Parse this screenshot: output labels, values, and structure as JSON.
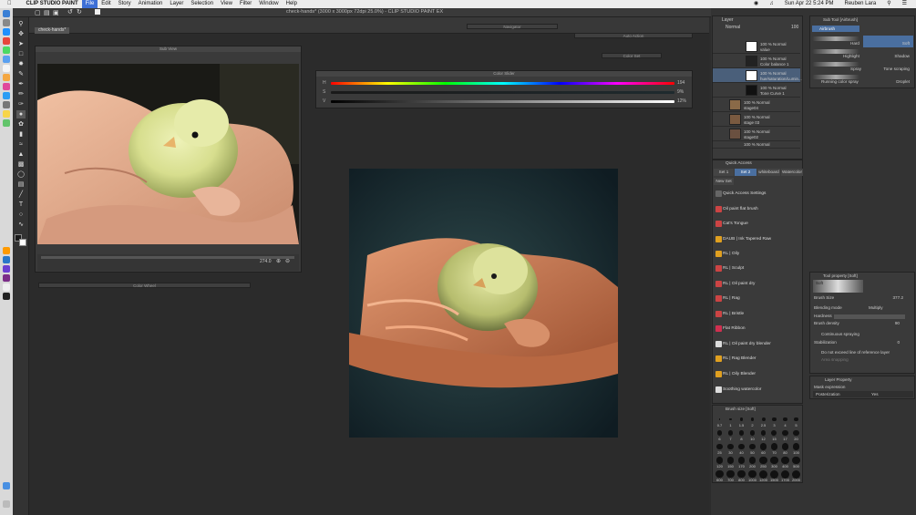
{
  "menubar": {
    "app_name": "CLIP STUDIO PAINT",
    "items": [
      "File",
      "Edit",
      "Story",
      "Animation",
      "Layer",
      "Selection",
      "View",
      "Filter",
      "Window",
      "Help"
    ],
    "active": "File",
    "clock": "Sun Apr 22  5:24 PM",
    "user": "Reuben Lara"
  },
  "window": {
    "title": "check-hands* (3000 x 3000px 72dpi 25.0%)  - CLIP STUDIO PAINT EX",
    "doc_tab": "check-hands*"
  },
  "panels": {
    "sub_view": {
      "title": "Sub View",
      "zoom": "274.0"
    },
    "navigator": {
      "title": "Navigator"
    },
    "auto_action": {
      "title": "Auto Action"
    },
    "color_set": {
      "title": "Color Set"
    },
    "color_wheel": {
      "title": "Color Wheel"
    },
    "color_slider": {
      "title": "Color Slider",
      "rows": [
        {
          "label": "H",
          "value": "194"
        },
        {
          "label": "S",
          "value": "9%"
        },
        {
          "label": "V",
          "value": "12%"
        }
      ]
    }
  },
  "layers": {
    "title": "Layer",
    "blend_mode": "Normal",
    "opacity": "100",
    "rows": [
      {
        "line1": "100 % Normal",
        "line2": "value"
      },
      {
        "line1": "100 % Normal",
        "line2": "Color balance 1"
      },
      {
        "line1": "100 % Normal",
        "line2": "hue/saturation/Lumin..."
      },
      {
        "line1": "100 % Normal",
        "line2": "Tone Curve 1"
      },
      {
        "line1": "100 % Normal",
        "line2": "stage04"
      },
      {
        "line1": "100 % Normal",
        "line2": "stage 03"
      },
      {
        "line1": "100 % Normal",
        "line2": "stage02"
      },
      {
        "line1": "100 % Normal",
        "line2": ""
      }
    ]
  },
  "quick_access": {
    "title": "Quick Access",
    "tabs": [
      "Set 1",
      "Set 2",
      "whiteboard",
      "Watercolor",
      "New Set"
    ],
    "settings_label": "Quick Access Settings",
    "items": [
      "Oil paint flat brush",
      "Cat's Tongue",
      "DAUB | Ink Tapered Raw",
      "RL | Oily",
      "RL | Sculpt",
      "RL | Oil paint dry",
      "RL | Rag",
      "RL | Bristle",
      "Flat Ribbon",
      "RL | Oil paint dry blender",
      "RL | Rag Blender",
      "RL | Oily Blender",
      "Soothing watercolor"
    ]
  },
  "brush_size": {
    "title": "Brush size [Soft]",
    "sizes": [
      "0.7",
      "1",
      "1.5",
      "2",
      "2.5",
      "3",
      "4",
      "5",
      "6",
      "7",
      "8",
      "10",
      "12",
      "15",
      "17",
      "20",
      "25",
      "30",
      "40",
      "50",
      "60",
      "70",
      "80",
      "100",
      "120",
      "150",
      "170",
      "200",
      "250",
      "300",
      "400",
      "500",
      "600",
      "700",
      "800",
      "1000",
      "1200",
      "1500",
      "1700",
      "2000"
    ]
  },
  "sub_tool": {
    "title": "Sub Tool [Airbrush]",
    "group": "Airbrush",
    "items": [
      {
        "left": "Hard",
        "right": "Soft"
      },
      {
        "left": "Highlight",
        "right": "Shadow"
      },
      {
        "left": "Spray",
        "right": "Tone scraping"
      },
      {
        "left": "Running color spray",
        "right": "Droplet"
      }
    ]
  },
  "tool_property": {
    "title": "Tool property [Soft]",
    "preview_label": "Soft",
    "rows": [
      {
        "label": "Brush Size",
        "value": "377.2"
      },
      {
        "label": "Blending mode",
        "value": "Multiply"
      },
      {
        "label": "Hardness",
        "value": ""
      },
      {
        "label": "Brush density",
        "value": "90"
      },
      {
        "label": "Continuous spraying",
        "value": ""
      },
      {
        "label": "Stabilization",
        "value": "0"
      },
      {
        "label": "Do not exceed line of reference layer",
        "value": ""
      },
      {
        "label": "Area snapping",
        "value": ""
      }
    ]
  },
  "layer_property": {
    "title": "Layer Property",
    "effect_label": "Mask expression",
    "row_label": "Posterization",
    "row_value": "Yes"
  }
}
